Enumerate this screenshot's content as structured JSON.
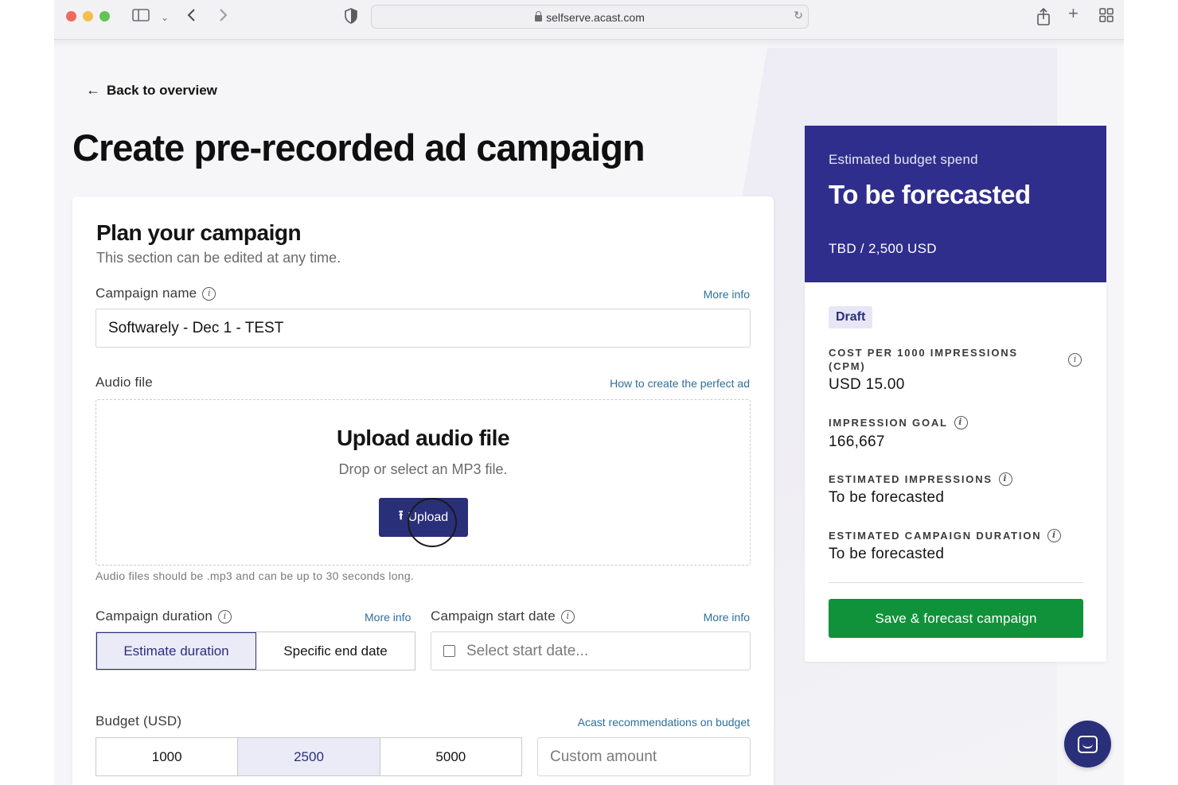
{
  "browser": {
    "url": "selfserve.acast.com",
    "icons": [
      "sidebar-icon",
      "chevron-down-icon",
      "back-icon",
      "forward-icon",
      "shield-icon",
      "reload-icon",
      "share-icon",
      "new-tab-icon",
      "tab-grid-icon"
    ]
  },
  "nav": {
    "back_label": "Back to overview"
  },
  "page": {
    "title": "Create pre-recorded ad campaign"
  },
  "plan": {
    "title": "Plan your campaign",
    "subtitle": "This section can be edited at any time.",
    "campaign_name_label": "Campaign name",
    "campaign_name_link": "More info",
    "campaign_name_value": "Softwarely - Dec 1 - TEST",
    "audio_label": "Audio file",
    "audio_link": "How to create the perfect ad",
    "upload_title": "Upload audio file",
    "upload_sub": "Drop or select an MP3 file.",
    "upload_button": "Upload",
    "audio_hint": "Audio files should be .mp3 and can be up to 30 seconds long.",
    "duration_label": "Campaign duration",
    "duration_link": "More info",
    "duration_options": [
      "Estimate duration",
      "Specific end date"
    ],
    "start_label": "Campaign start date",
    "start_link": "More info",
    "start_placeholder": "Select start date...",
    "budget_label": "Budget (USD)",
    "budget_link": "Acast recommendations on budget",
    "budget_options": [
      "1000",
      "2500",
      "5000"
    ],
    "budget_selected": "2500",
    "custom_placeholder": "Custom amount"
  },
  "summary": {
    "label": "Estimated budget spend",
    "headline": "To be forecasted",
    "budget_line": "TBD / 2,500 USD",
    "status_badge": "Draft",
    "stats": [
      {
        "label": "COST PER 1000 IMPRESSIONS (CPM)",
        "value": "USD 15.00"
      },
      {
        "label": "IMPRESSION GOAL",
        "value": "166,667"
      },
      {
        "label": "ESTIMATED IMPRESSIONS",
        "value": "To be forecasted"
      },
      {
        "label": "ESTIMATED CAMPAIGN DURATION",
        "value": "To be forecasted"
      }
    ],
    "save_button": "Save & forecast campaign"
  },
  "colors": {
    "brand_navy": "#302e8c",
    "button_navy": "#2a2f7a",
    "save_green": "#10923a",
    "link_blue": "#2e6f9a"
  }
}
